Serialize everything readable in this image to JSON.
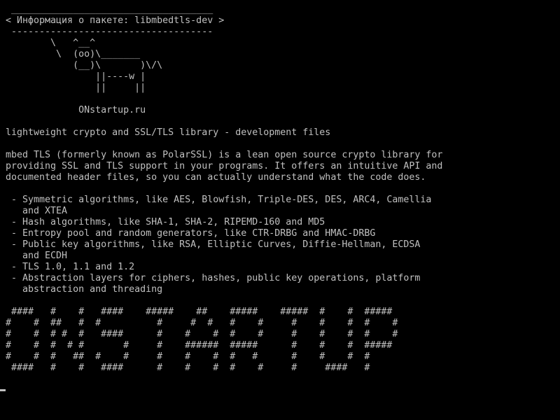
{
  "terminal": {
    "lines": [
      " ____________________________________",
      "< Информация о пакете: libmbedtls-dev >",
      " ------------------------------------",
      "        \\   ^__^",
      "         \\  (oo)\\_______",
      "            (__)\\       )\\/\\",
      "                ||----w |",
      "                ||     ||",
      "",
      "             ONstartup.ru",
      "",
      "lightweight crypto and SSL/TLS library - development files",
      "",
      "mbed TLS (formerly known as PolarSSL) is a lean open source crypto library for",
      "providing SSL and TLS support in your programs. It offers an intuitive API and",
      "documented header files, so you can actually understand what the code does.",
      "",
      " - Symmetric algorithms, like AES, Blowfish, Triple-DES, DES, ARC4, Camellia",
      "   and XTEA",
      " - Hash algorithms, like SHA-1, SHA-2, RIPEMD-160 and MD5",
      " - Entropy pool and random generators, like CTR-DRBG and HMAC-DRBG",
      " - Public key algorithms, like RSA, Elliptic Curves, Diffie-Hellman, ECDSA",
      "   and ECDH",
      " - TLS 1.0, 1.1 and 1.2",
      " - Abstraction layers for ciphers, hashes, public key operations, platform",
      "   abstraction and threading",
      "",
      " ####   #    #   ####    #####    ##    #####    #####  #    #  #####",
      "#    #  ##   #  #          #     #  #   #    #     #    #    #  #    #",
      "#    #  # #  #   ####      #    #    #  #    #     #    #    #  #    #",
      "#    #  #  # #       #     #    ######  #####      #    #    #  #####",
      "#    #  #   ##  #    #     #    #    #  #   #      #    #    #  #",
      " ####   #    #   ####      #    #    #  #    #     #     ####   #"
    ]
  }
}
